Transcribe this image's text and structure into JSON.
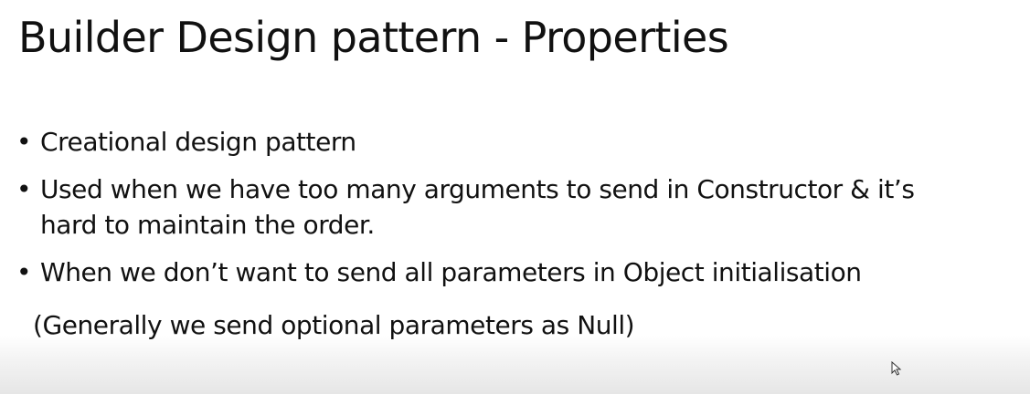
{
  "slide": {
    "title": "Builder Design pattern - Properties",
    "bullets": [
      {
        "lines": [
          "Creational design pattern"
        ]
      },
      {
        "lines": [
          "Used when we have too many arguments to send in Constructor & it’s",
          "hard to maintain the order."
        ]
      },
      {
        "lines": [
          "When we don’t want to send all parameters in Object initialisation"
        ]
      }
    ],
    "note": "(Generally we send optional parameters as Null)",
    "bullet_symbol": "•"
  },
  "icons": {
    "cursor": "mouse-pointer-icon"
  },
  "colors": {
    "text": "#111111",
    "background": "#ffffff",
    "bottom_fade": "#e6e6e6"
  }
}
